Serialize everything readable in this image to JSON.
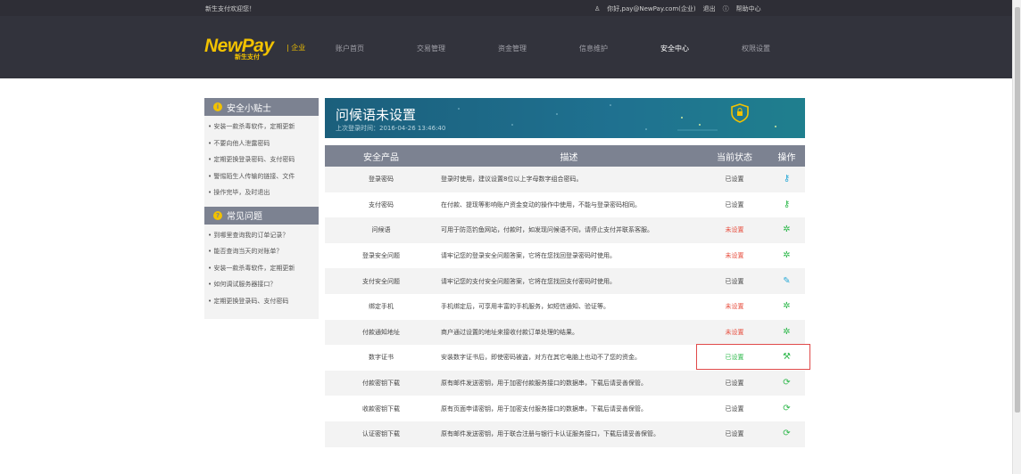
{
  "topbar": {
    "welcome": "新生支付欢迎您！",
    "greeting": "你好,pay@NewPay.com(企业)",
    "logout": "退出",
    "help": "帮助中心"
  },
  "logo": {
    "brand": "NewPay",
    "sub": "新生支付",
    "tag": "| 企业"
  },
  "nav": [
    "账户首页",
    "交易管理",
    "资金管理",
    "信息维护",
    "安全中心",
    "权限设置"
  ],
  "nav_active": "安全中心",
  "sidebar": {
    "tips_title": "安全小贴士",
    "tips": [
      "• 安装一款杀毒软件，定期更新",
      "• 不要向他人泄露密码",
      "• 定期更换登录密码、支付密码",
      "• 警惕陌生人传输的链接、文件",
      "• 操作完毕，及时退出"
    ],
    "faq_title": "常见问题",
    "faq": [
      "• 到哪里查询我的订单记录？",
      "• 能否查询当天的对账单？",
      "• 安装一款杀毒软件，定期更新",
      "• 如何调试服务器接口？",
      "• 定期更换登录码、支付密码"
    ]
  },
  "banner": {
    "title": "问候语未设置",
    "last_login": "上次登录时间：2016-04-26 13:46:40"
  },
  "table": {
    "headers": [
      "安全产品",
      "描述",
      "当前状态",
      "操作"
    ],
    "rows": [
      {
        "product": "登录密码",
        "desc": "登录时使用，建议设置8位以上字母数字组合密码。",
        "status": "已设置",
        "status_type": "set",
        "op_icon": "key-icon",
        "op_glyph": "⚷",
        "op_color": "blue"
      },
      {
        "product": "支付密码",
        "desc": "在付款、提现等影响账户资金变动的操作中使用，不能与登录密码相同。",
        "status": "已设置",
        "status_type": "set",
        "op_icon": "key-icon",
        "op_glyph": "⚷",
        "op_color": "green"
      },
      {
        "product": "问候语",
        "desc": "可用于防范钓鱼网站，付款时，如发现问候语不同，请停止支付并联系客服。",
        "status": "未设置",
        "status_type": "unset",
        "op_icon": "gear-icon",
        "op_glyph": "✲",
        "op_color": "green"
      },
      {
        "product": "登录安全问题",
        "desc": "请牢记您的登录安全问题答案，它将在您找回登录密码时使用。",
        "status": "未设置",
        "status_type": "unset",
        "op_icon": "gear-icon",
        "op_glyph": "✲",
        "op_color": "green"
      },
      {
        "product": "支付安全问题",
        "desc": "请牢记您的支付安全问题答案，它将在您找回支付密码时使用。",
        "status": "已设置",
        "status_type": "set",
        "op_icon": "pencil-icon",
        "op_glyph": "✎",
        "op_color": "blue"
      },
      {
        "product": "绑定手机",
        "desc": "手机绑定后，可享用丰富的手机服务，如短信通知、验证等。",
        "status": "未设置",
        "status_type": "unset",
        "op_icon": "gear-icon",
        "op_glyph": "✲",
        "op_color": "green"
      },
      {
        "product": "付款通知地址",
        "desc": "商户通过设置的地址来接收付款订单处理的结果。",
        "status": "未设置",
        "status_type": "unset",
        "op_icon": "gear-icon",
        "op_glyph": "✲",
        "op_color": "green"
      },
      {
        "product": "数字证书",
        "desc": "安装数字证书后，即使密码被盗，对方在其它电脑上也动不了您的资金。",
        "status": "已设置",
        "status_type": "green",
        "op_icon": "wrench-icon",
        "op_glyph": "⚒",
        "op_color": "green"
      },
      {
        "product": "付款密钥下载",
        "desc": "原有邮件发送密钥，用于加密付款服务接口的数据串，下载后请妥善保管。",
        "status": "已设置",
        "status_type": "set",
        "op_icon": "refresh-icon",
        "op_glyph": "⟳",
        "op_color": "green"
      },
      {
        "product": "收款密钥下载",
        "desc": "原有页面申请密钥，用于加密支付服务接口的数据串，下载后请妥善保管。",
        "status": "已设置",
        "status_type": "set",
        "op_icon": "refresh-icon",
        "op_glyph": "⟳",
        "op_color": "green"
      },
      {
        "product": "认证密钥下载",
        "desc": "原有邮件发送密钥，用于联合注册与银行卡认证服务接口，下载后请妥善保管。",
        "status": "已设置",
        "status_type": "set",
        "op_icon": "refresh-icon",
        "op_glyph": "⟳",
        "op_color": "green"
      }
    ]
  },
  "colors": {
    "accent": "#f2c200",
    "header_bg": "#32333c",
    "table_head": "#7c8291",
    "unset": "#e74c3c",
    "ok_green": "#2eb84b",
    "highlight": "#e04a4a"
  }
}
